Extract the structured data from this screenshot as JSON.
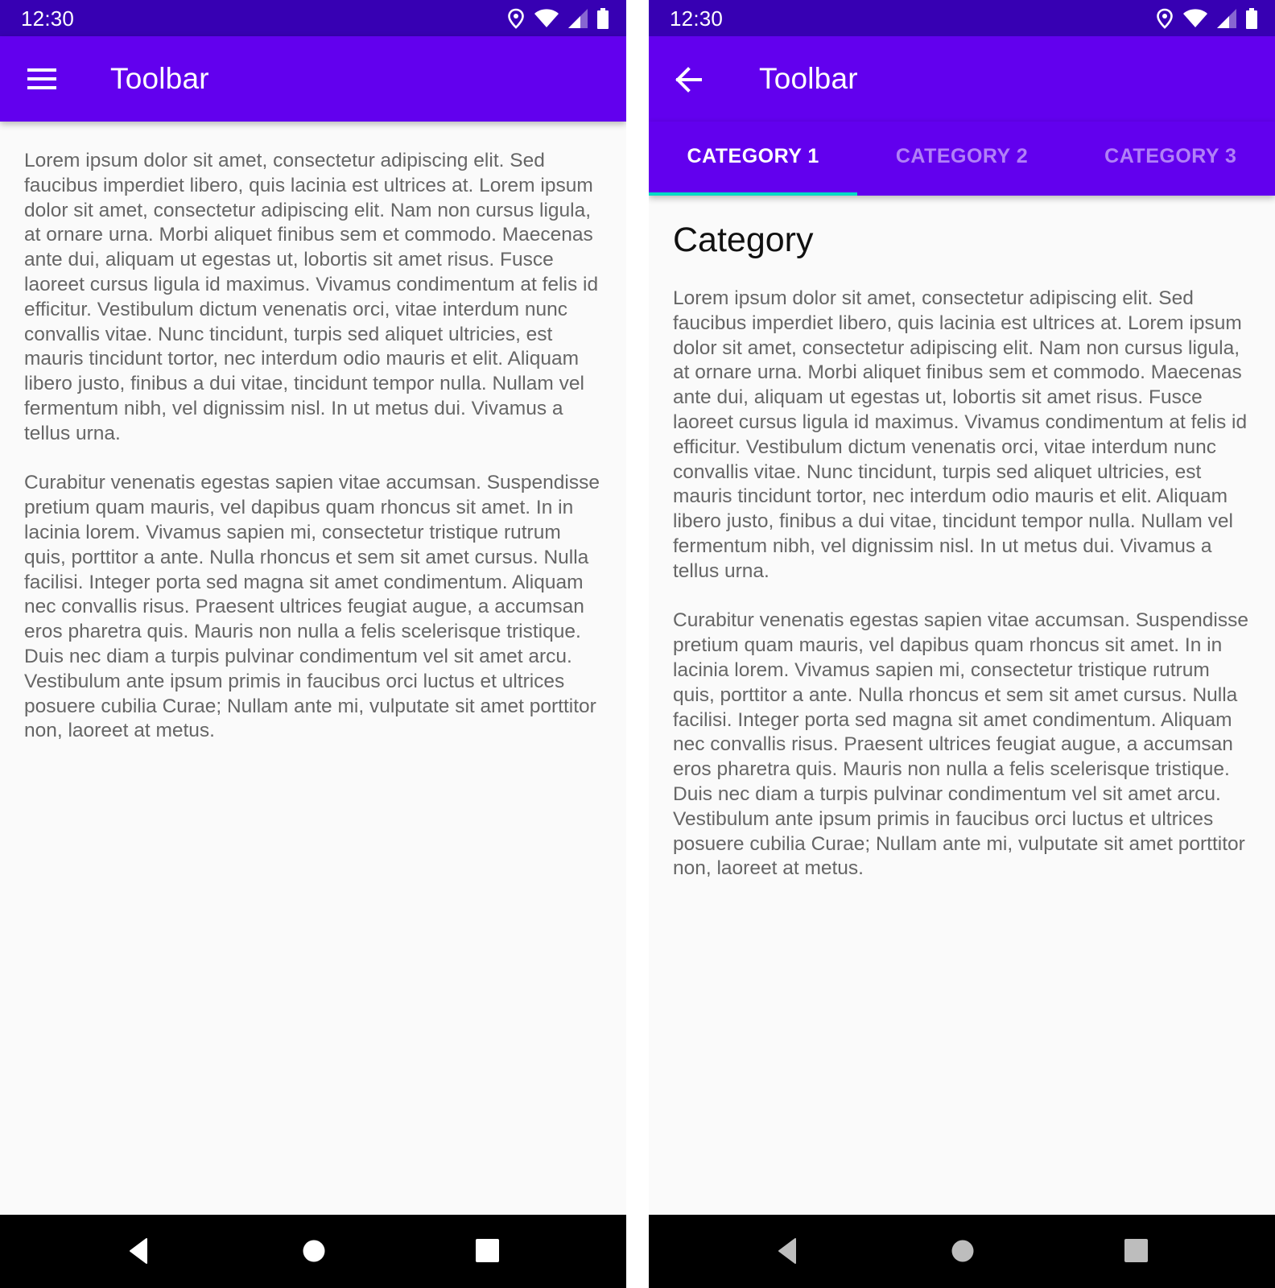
{
  "colors": {
    "status_bar": "#3700b3",
    "primary": "#6200ee",
    "tab_indicator": "#03dac5",
    "background": "#fafafa",
    "body_text": "#666666",
    "nav_bar": "#000000"
  },
  "screens": [
    {
      "status_bar": {
        "time": "12:30",
        "icons": [
          "location-icon",
          "wifi-icon",
          "cellular-signal-icon",
          "battery-icon"
        ]
      },
      "toolbar": {
        "nav_icon": "menu-icon",
        "title": "Toolbar"
      },
      "content": {
        "paragraphs": [
          "Lorem ipsum dolor sit amet, consectetur adipiscing elit. Sed faucibus imperdiet libero, quis lacinia est ultrices at. Lorem ipsum dolor sit amet, consectetur adipiscing elit. Nam non cursus ligula, at ornare urna. Morbi aliquet finibus sem et commodo. Maecenas ante dui, aliquam ut egestas ut, lobortis sit amet risus. Fusce laoreet cursus ligula id maximus. Vivamus condimentum at felis id efficitur. Vestibulum dictum venenatis orci, vitae interdum nunc convallis vitae. Nunc tincidunt, turpis sed aliquet ultricies, est mauris tincidunt tortor, nec interdum odio mauris et elit. Aliquam libero justo, finibus a dui vitae, tincidunt tempor nulla. Nullam vel fermentum nibh, vel dignissim nisl. In ut metus dui. Vivamus a tellus urna.",
          "Curabitur venenatis egestas sapien vitae accumsan. Suspendisse pretium quam mauris, vel dapibus quam rhoncus sit amet. In in lacinia lorem. Vivamus sapien mi, consectetur tristique rutrum quis, porttitor a ante. Nulla rhoncus et sem sit amet cursus. Nulla facilisi. Integer porta sed magna sit amet condimentum. Aliquam nec convallis risus. Praesent ultrices feugiat augue, a accumsan eros pharetra quis. Mauris non nulla a felis scelerisque tristique. Duis nec diam a turpis pulvinar condimentum vel sit amet arcu. Vestibulum ante ipsum primis in faucibus orci luctus et ultrices posuere cubilia Curae; Nullam ante mi, vulputate sit amet porttitor non, laoreet at metus."
        ]
      },
      "nav_bar": {
        "buttons": [
          "back-icon",
          "home-icon",
          "recents-icon"
        ],
        "icon_color": "#ffffff"
      }
    },
    {
      "status_bar": {
        "time": "12:30",
        "icons": [
          "location-icon",
          "wifi-icon",
          "cellular-signal-icon",
          "battery-icon"
        ]
      },
      "toolbar": {
        "nav_icon": "arrow-back-icon",
        "title": "Toolbar"
      },
      "tabs": [
        {
          "label": "CATEGORY 1",
          "selected": true
        },
        {
          "label": "CATEGORY 2",
          "selected": false
        },
        {
          "label": "CATEGORY 3",
          "selected": false
        }
      ],
      "content": {
        "heading": "Category",
        "paragraphs": [
          "Lorem ipsum dolor sit amet, consectetur adipiscing elit. Sed faucibus imperdiet libero, quis lacinia est ultrices at. Lorem ipsum dolor sit amet, consectetur adipiscing elit. Nam non cursus ligula, at ornare urna. Morbi aliquet finibus sem et commodo. Maecenas ante dui, aliquam ut egestas ut, lobortis sit amet risus. Fusce laoreet cursus ligula id maximus. Vivamus condimentum at felis id efficitur. Vestibulum dictum venenatis orci, vitae interdum nunc convallis vitae. Nunc tincidunt, turpis sed aliquet ultricies, est mauris tincidunt tortor, nec interdum odio mauris et elit. Aliquam libero justo, finibus a dui vitae, tincidunt tempor nulla. Nullam vel fermentum nibh, vel dignissim nisl. In ut metus dui. Vivamus a tellus urna.",
          "Curabitur venenatis egestas sapien vitae accumsan. Suspendisse pretium quam mauris, vel dapibus quam rhoncus sit amet. In in lacinia lorem. Vivamus sapien mi, consectetur tristique rutrum quis, porttitor a ante. Nulla rhoncus et sem sit amet cursus. Nulla facilisi. Integer porta sed magna sit amet condimentum. Aliquam nec convallis risus. Praesent ultrices feugiat augue, a accumsan eros pharetra quis. Mauris non nulla a felis scelerisque tristique. Duis nec diam a turpis pulvinar condimentum vel sit amet arcu. Vestibulum ante ipsum primis in faucibus orci luctus et ultrices posuere cubilia Curae; Nullam ante mi, vulputate sit amet porttitor non, laoreet at metus."
        ]
      },
      "nav_bar": {
        "buttons": [
          "back-icon",
          "home-icon",
          "recents-icon"
        ],
        "icon_color": "#bdbdbd"
      }
    }
  ]
}
